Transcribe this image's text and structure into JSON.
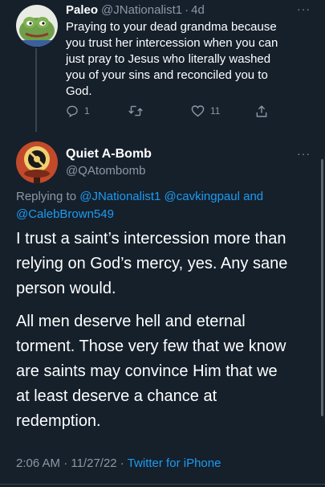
{
  "parent": {
    "display_name": "Paleo",
    "handle": "@JNationalist1",
    "separator": "·",
    "time": "4d",
    "text_lines": [
      "Praying to your dead grandma because",
      "you trust her intercession when you can",
      "just pray to Jesus who literally washed",
      "you of your sins and reconciled you to",
      "God."
    ],
    "reply_count": "1",
    "retweet_count": "",
    "like_count": "11",
    "more": "···"
  },
  "main": {
    "display_name": "Quiet A-Bomb",
    "handle": "@QAtombomb",
    "more": "···",
    "replying_prefix": "Replying to",
    "replying_to": [
      "@JNationalist1",
      "@cavkingpaul and",
      "@CalebBrown549"
    ],
    "paragraph1_lines": [
      "I trust a saint’s intercession more than",
      "relying on God’s mercy, yes. Any sane",
      "person would."
    ],
    "paragraph2_lines": [
      "All men deserve hell and eternal",
      "torment. Those very few that we know",
      "are saints may convince Him that we",
      "at least deserve a chance at",
      "redemption."
    ],
    "timestamp": "2:06 AM · 11/27/22 ·",
    "source": "Twitter for iPhone"
  },
  "colors": {
    "background": "#15202b",
    "accent": "#1d9bf0",
    "secondary_text": "#8b98a5",
    "divider": "#38444d"
  }
}
